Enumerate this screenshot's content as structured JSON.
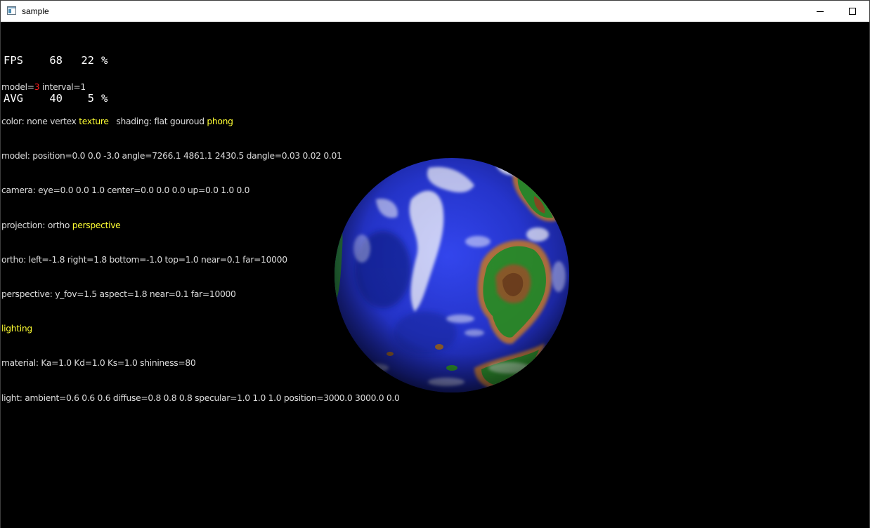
{
  "window": {
    "title": "sample",
    "icon": "app-window-icon",
    "controls": [
      "minimize-icon",
      "maximize-icon"
    ]
  },
  "colors": {
    "background": "#000000",
    "text": "#dcdcdc",
    "highlight_selected": "#ffff33",
    "highlight_model": "#ff2020",
    "ocean": "#2a3cd8",
    "land": "#2c8a2c",
    "mountain": "#8a5a2a",
    "cloud": "#ffffff"
  },
  "stats": {
    "fps": {
      "label": "FPS",
      "value": "68",
      "percent": "22",
      "unit": "%"
    },
    "avg": {
      "label": "AVG",
      "value": "40",
      "percent": "5",
      "unit": "%"
    }
  },
  "info": {
    "model_prefix": "model=",
    "model_value": "3",
    "model_suffix": " interval=1",
    "color_prefix": "color: none vertex ",
    "color_selected": "texture",
    "shading_prefix": "   shading: flat gouroud ",
    "shading_selected": "phong",
    "model_line": "model: position=0.0 0.0 -3.0 angle=7266.1 4861.1 2430.5 dangle=0.03 0.02 0.01",
    "camera_line": "camera: eye=0.0 0.0 1.0 center=0.0 0.0 0.0 up=0.0 1.0 0.0",
    "projection_prefix": "projection: ortho ",
    "projection_selected": "perspective",
    "ortho_line": "ortho: left=-1.8 right=1.8 bottom=-1.0 top=1.0 near=0.1 far=10000",
    "perspective_line": "perspective: y_fov=1.5 aspect=1.8 near=0.1 far=10000",
    "lighting_label": "lighting",
    "material_line": "material: Ka=1.0 Kd=1.0 Ks=1.0 shininess=80",
    "light_line": "light: ambient=0.6 0.6 0.6 diffuse=0.8 0.8 0.8 specular=1.0 1.0 1.0 position=3000.0 3000.0 0.0"
  },
  "scene": {
    "object": "earth-globe"
  }
}
